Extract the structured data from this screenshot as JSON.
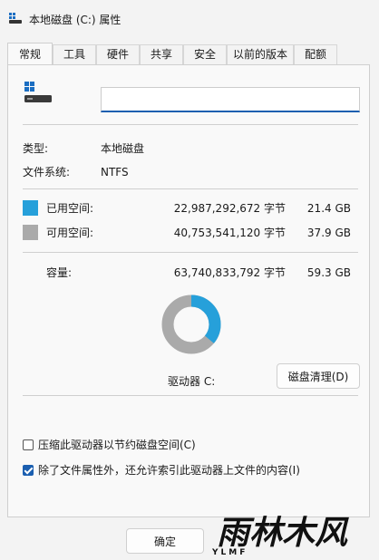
{
  "window": {
    "title": "本地磁盘 (C:) 属性"
  },
  "tabs": [
    {
      "label": "常规",
      "active": true
    },
    {
      "label": "工具",
      "active": false
    },
    {
      "label": "硬件",
      "active": false
    },
    {
      "label": "共享",
      "active": false
    },
    {
      "label": "安全",
      "active": false
    },
    {
      "label": "以前的版本",
      "active": false
    },
    {
      "label": "配额",
      "active": false
    }
  ],
  "general": {
    "drive_name_value": "",
    "type_label": "类型:",
    "type_value": "本地磁盘",
    "fs_label": "文件系统:",
    "fs_value": "NTFS",
    "used": {
      "label": "已用空间:",
      "bytes": "22,987,292,672 字节",
      "size": "21.4 GB",
      "color": "#26a0da"
    },
    "free": {
      "label": "可用空间:",
      "bytes": "40,753,541,120 字节",
      "size": "37.9 GB",
      "color": "#aaaaaa"
    },
    "capacity": {
      "label": "容量:",
      "bytes": "63,740,833,792 字节",
      "size": "59.3 GB"
    },
    "drive_label": "驱动器 C:",
    "cleanup_button": "磁盘清理(D)",
    "compress_label": "压缩此驱动器以节约磁盘空间(C)",
    "compress_checked": false,
    "index_label": "除了文件属性外，还允许索引此驱动器上文件的内容(I)",
    "index_checked": true
  },
  "footer": {
    "ok_button": "确定"
  },
  "watermark": {
    "text": "雨林木风",
    "sub": "YLMF"
  }
}
